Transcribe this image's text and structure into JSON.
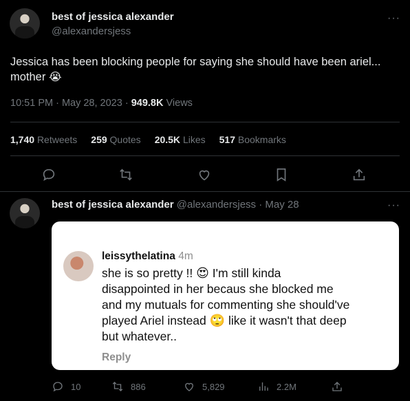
{
  "tweet": {
    "author": {
      "name": "best of jessica alexander",
      "handle": "@alexandersjess"
    },
    "text": "Jessica has been blocking people for saying she should have been ariel... mother",
    "emoji": "😭",
    "time": "10:51 PM · May 28, 2023 ·",
    "views_count": "949.8K",
    "views_label": "Views",
    "stats": [
      {
        "count": "1,740",
        "label": "Retweets"
      },
      {
        "count": "259",
        "label": "Quotes"
      },
      {
        "count": "20.5K",
        "label": "Likes"
      },
      {
        "count": "517",
        "label": "Bookmarks"
      }
    ],
    "more": "···"
  },
  "reply": {
    "author": {
      "name": "best of jessica alexander",
      "handle": "@alexandersjess · May 28"
    },
    "more": "···",
    "instagram": {
      "user": "leissythelatina",
      "time": "4m",
      "line1a": "she is so pretty !!",
      "line1b": "I'm still kinda",
      "line2": "disappointed in her becaus she blocked me",
      "line3": "and my mutuals for commenting she should've",
      "line4a": "played Ariel instead",
      "line4b": "like it wasn't that deep",
      "line5": "but whatever..",
      "reply_label": "Reply",
      "emoji_heart_eyes": "😍",
      "emoji_eyeroll": "🙄"
    },
    "actions": {
      "replies": "10",
      "retweets": "886",
      "likes": "5,829",
      "views": "2.2M"
    }
  },
  "icons": [
    "reply-icon",
    "retweet-icon",
    "like-icon",
    "bookmark-icon",
    "share-icon",
    "views-icon"
  ],
  "colors": {
    "background": "#000000",
    "text": "#e7e9ea",
    "muted": "#71767b",
    "divider": "#2f3336"
  }
}
